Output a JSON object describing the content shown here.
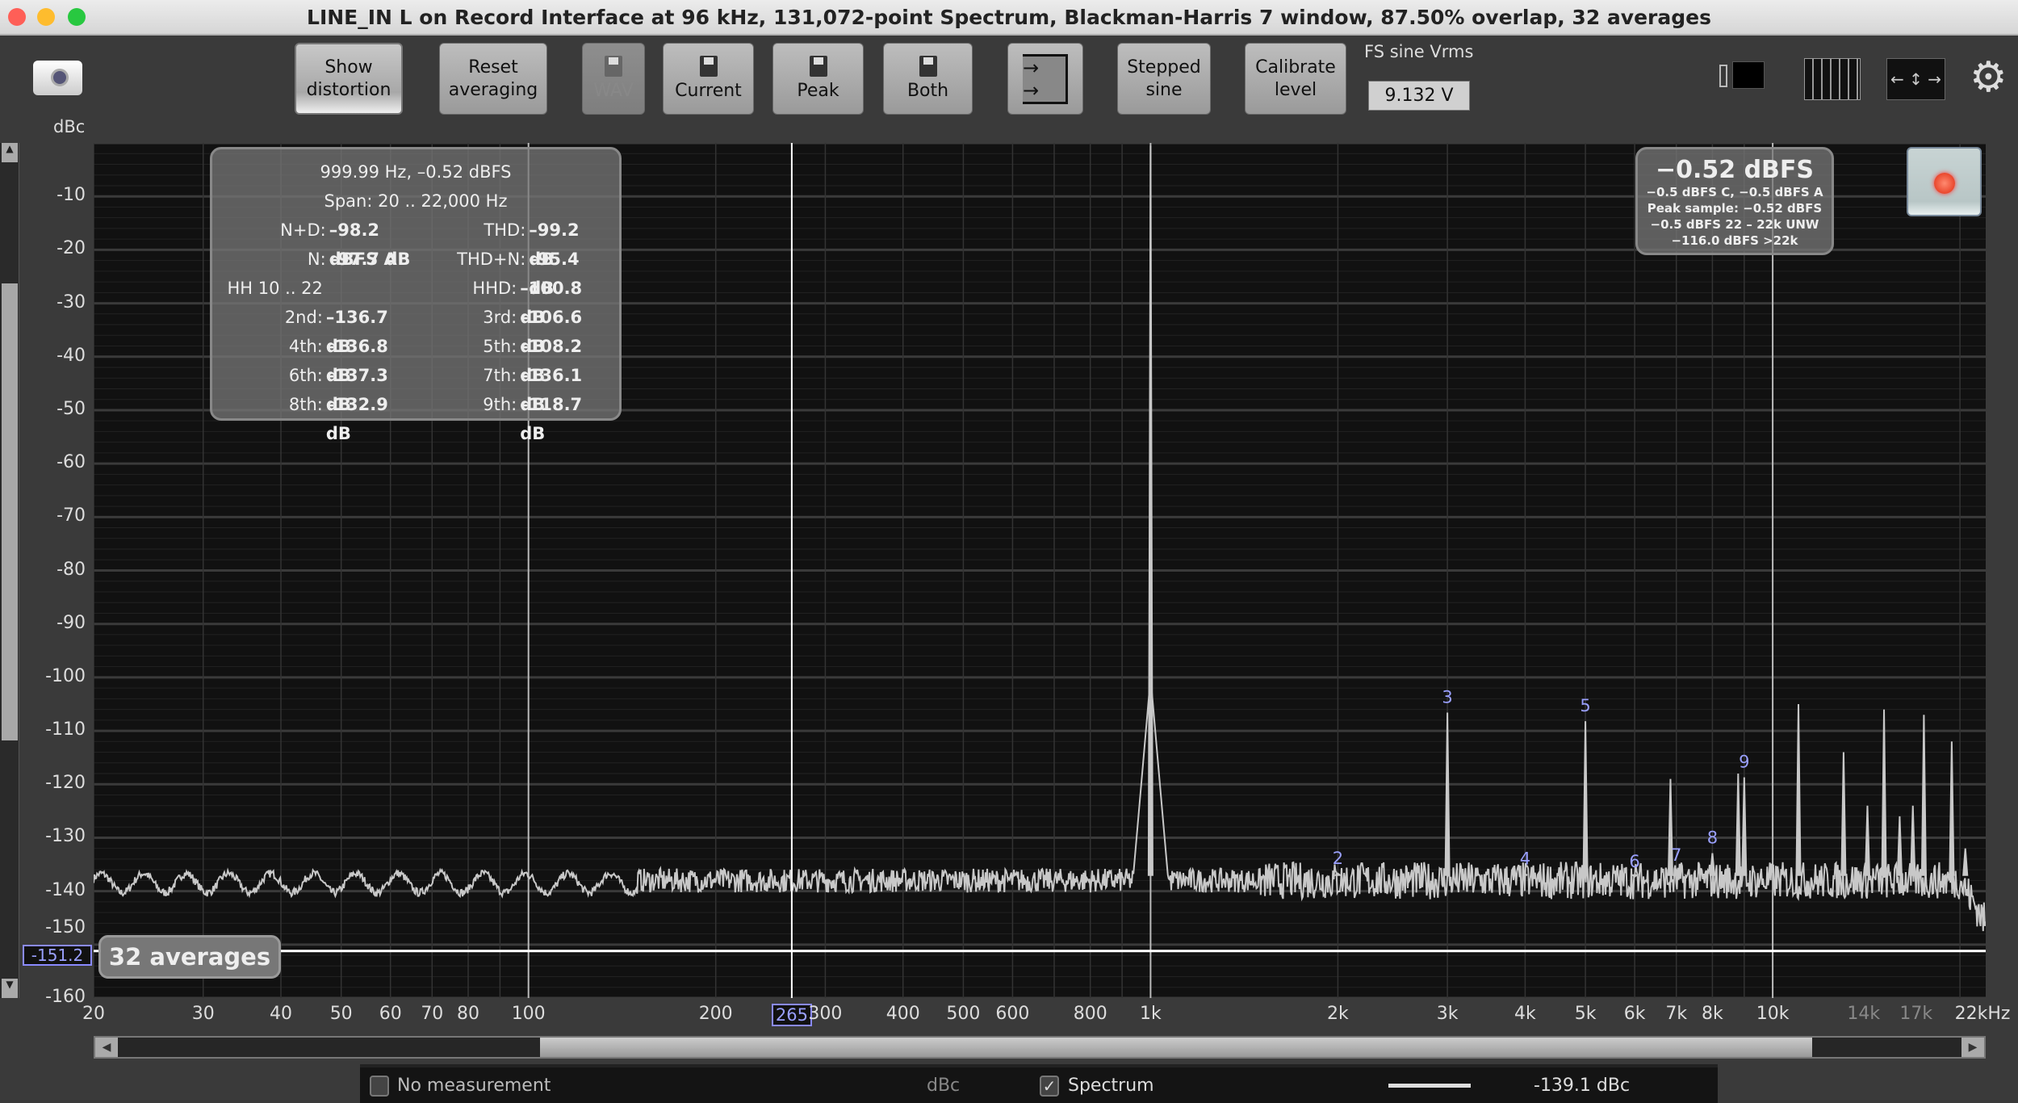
{
  "window": {
    "title": "LINE_IN L on Record Interface at 96 kHz, 131,072-point Spectrum, Blackman-Harris 7 window, 87.50% overlap, 32 averages"
  },
  "toolbar": {
    "show_distortion": [
      "Show",
      "distortion"
    ],
    "reset_averaging": [
      "Reset",
      "averaging"
    ],
    "wav": "WAV",
    "current": "Current",
    "peak": "Peak",
    "both": "Both",
    "stepped_sine": [
      "Stepped",
      "sine"
    ],
    "calibrate_level": [
      "Calibrate",
      "level"
    ],
    "fs_label": "FS sine Vrms",
    "fs_value": "9.132 V"
  },
  "axis": {
    "y_unit": "dBc",
    "y_ticks": [
      "-10",
      "-20",
      "-30",
      "-40",
      "-50",
      "-60",
      "-70",
      "-80",
      "-90",
      "-100",
      "-110",
      "-120",
      "-130",
      "-140",
      "-150",
      "-160"
    ],
    "x_ticks": [
      {
        "f": 20,
        "label": "20"
      },
      {
        "f": 30,
        "label": "30"
      },
      {
        "f": 40,
        "label": "40"
      },
      {
        "f": 50,
        "label": "50"
      },
      {
        "f": 60,
        "label": "60"
      },
      {
        "f": 70,
        "label": "70"
      },
      {
        "f": 80,
        "label": "80"
      },
      {
        "f": 100,
        "label": "100"
      },
      {
        "f": 200,
        "label": "200"
      },
      {
        "f": 300,
        "label": "300"
      },
      {
        "f": 400,
        "label": "400"
      },
      {
        "f": 500,
        "label": "500"
      },
      {
        "f": 600,
        "label": "600"
      },
      {
        "f": 800,
        "label": "800"
      },
      {
        "f": 1000,
        "label": "1k"
      },
      {
        "f": 2000,
        "label": "2k"
      },
      {
        "f": 3000,
        "label": "3k"
      },
      {
        "f": 4000,
        "label": "4k"
      },
      {
        "f": 5000,
        "label": "5k"
      },
      {
        "f": 6000,
        "label": "6k"
      },
      {
        "f": 7000,
        "label": "7k"
      },
      {
        "f": 8000,
        "label": "8k"
      },
      {
        "f": 10000,
        "label": "10k"
      },
      {
        "f": 14000,
        "label": "14k",
        "dim": true
      },
      {
        "f": 17000,
        "label": "17k",
        "dim": true
      },
      {
        "f": 21000,
        "label": "22kHz"
      }
    ],
    "x_range_hz": [
      20,
      22000
    ],
    "y_range_db": [
      -160,
      0
    ],
    "cursor_freq": "265",
    "cursor_level": "-151.2"
  },
  "info": {
    "header": "999.99 Hz, –0.52 dBFS",
    "span": "Span: 20 .. 22,000 Hz",
    "rows": [
      [
        "N+D:",
        "–98.2 dBFS A",
        "THD:",
        "–99.2 dB"
      ],
      [
        "N:",
        "–97.7 dB",
        "THD+N:",
        "–95.4 dB"
      ],
      [
        "HH 10 .. 22",
        "",
        "HHD:",
        "–100.8 dB"
      ],
      [
        "2nd:",
        "–136.7 dB",
        "3rd:",
        "–106.6 dB"
      ],
      [
        "4th:",
        "–136.8 dB",
        "5th:",
        "–108.2 dB"
      ],
      [
        "6th:",
        "–137.3 dB",
        "7th:",
        "–136.1 dB"
      ],
      [
        "8th:",
        "–132.9 dB",
        "9th:",
        "–118.7 dB"
      ]
    ]
  },
  "level": {
    "main": "−0.52 dBFS",
    "lines": [
      "−0.5 dBFS C, −0.5 dBFS A",
      "Peak sample: −0.52 dBFS",
      "−0.5 dBFS 22 – 22k UNW",
      "−116.0 dBFS >22k"
    ]
  },
  "averages_badge": "32 averages",
  "bottom": {
    "no_measurement": "No measurement",
    "unit": "dBc",
    "spectrum": "Spectrum",
    "spectrum_checked": true,
    "readout": "-139.1 dBc"
  },
  "colors": {
    "trace": "#c8c8c8",
    "harmonic_label": "#9aa0ff",
    "background": "#111111"
  },
  "chart_data": {
    "type": "line",
    "x_scale": "log",
    "xlim": [
      20,
      22000
    ],
    "ylim": [
      -160,
      0
    ],
    "fundamental": {
      "f": 1000,
      "db": -0.52
    },
    "harmonics": [
      {
        "n": "2",
        "f": 2000,
        "db": -136.7
      },
      {
        "n": "3",
        "f": 3000,
        "db": -106.6
      },
      {
        "n": "4",
        "f": 4000,
        "db": -136.8
      },
      {
        "n": "5",
        "f": 5000,
        "db": -108.2
      },
      {
        "n": "6",
        "f": 6000,
        "db": -137.3
      },
      {
        "n": "7",
        "f": 7000,
        "db": -136.1
      },
      {
        "n": "8",
        "f": 8000,
        "db": -132.9
      },
      {
        "n": "9",
        "f": 9000,
        "db": -118.7
      }
    ],
    "spurs": [
      {
        "f": 6850,
        "db": -119
      },
      {
        "f": 8800,
        "db": -118
      },
      {
        "f": 11000,
        "db": -105
      },
      {
        "f": 13000,
        "db": -114
      },
      {
        "f": 14200,
        "db": -124
      },
      {
        "f": 15100,
        "db": -106
      },
      {
        "f": 16000,
        "db": -126
      },
      {
        "f": 16800,
        "db": -124
      },
      {
        "f": 17500,
        "db": -107
      },
      {
        "f": 19400,
        "db": -112
      },
      {
        "f": 20400,
        "db": -132
      }
    ],
    "noise_floor_db": -138
  }
}
